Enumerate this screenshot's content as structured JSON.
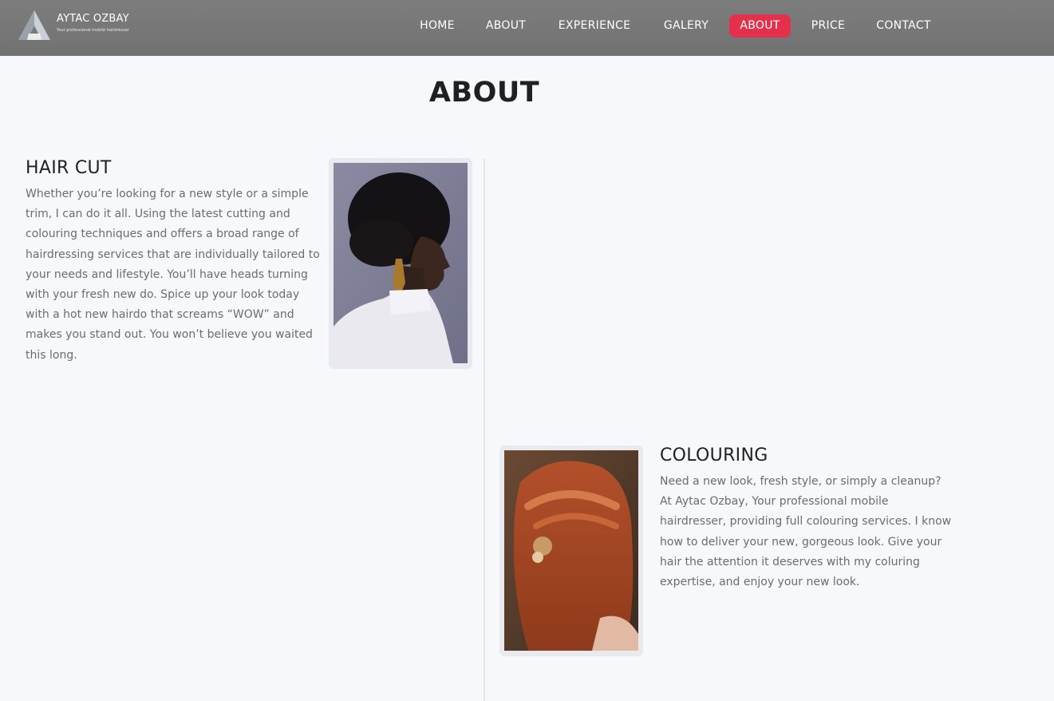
{
  "brand": {
    "name": "AYTAC OZBAY",
    "tagline": "Your professional mobile hairdresser"
  },
  "nav": {
    "items": [
      {
        "label": "HOME"
      },
      {
        "label": "ABOUT"
      },
      {
        "label": "EXPERIENCE"
      },
      {
        "label": "GALERY"
      },
      {
        "label": "ABOUT",
        "active": true
      },
      {
        "label": "PRICE"
      },
      {
        "label": "CONTACT"
      }
    ]
  },
  "colors": {
    "header": "#777777",
    "accent": "#e3314b",
    "background": "#f7f8fb",
    "heading": "#1f1f24",
    "body_text": "#6b6b72"
  },
  "page": {
    "title": "ABOUT"
  },
  "sections": [
    {
      "title": "HAIR CUT",
      "text": "Whether you’re looking for a new style or a simple trim, I can do it all. Using the latest cutting and colouring techniques and offers a broad range of hairdressing services that are individually tailored to your needs and lifestyle. You’ll have heads turning with your fresh new do. Spice up your look today with a hot new hairdo that screams “WOW” and makes you stand out. You won’t believe you waited this long.",
      "image": "woman-profile-afro-photo"
    },
    {
      "title": "COLOURING",
      "text": "Need a new look, fresh style, or simply a cleanup? At Aytac Ozbay, Your professional mobile hairdresser, providing full colouring services. I know how to deliver your new, gorgeous look. Give your hair the attention it deserves with my coluring expertise, and enjoy your new look.",
      "image": "red-braided-hair-photo"
    }
  ]
}
